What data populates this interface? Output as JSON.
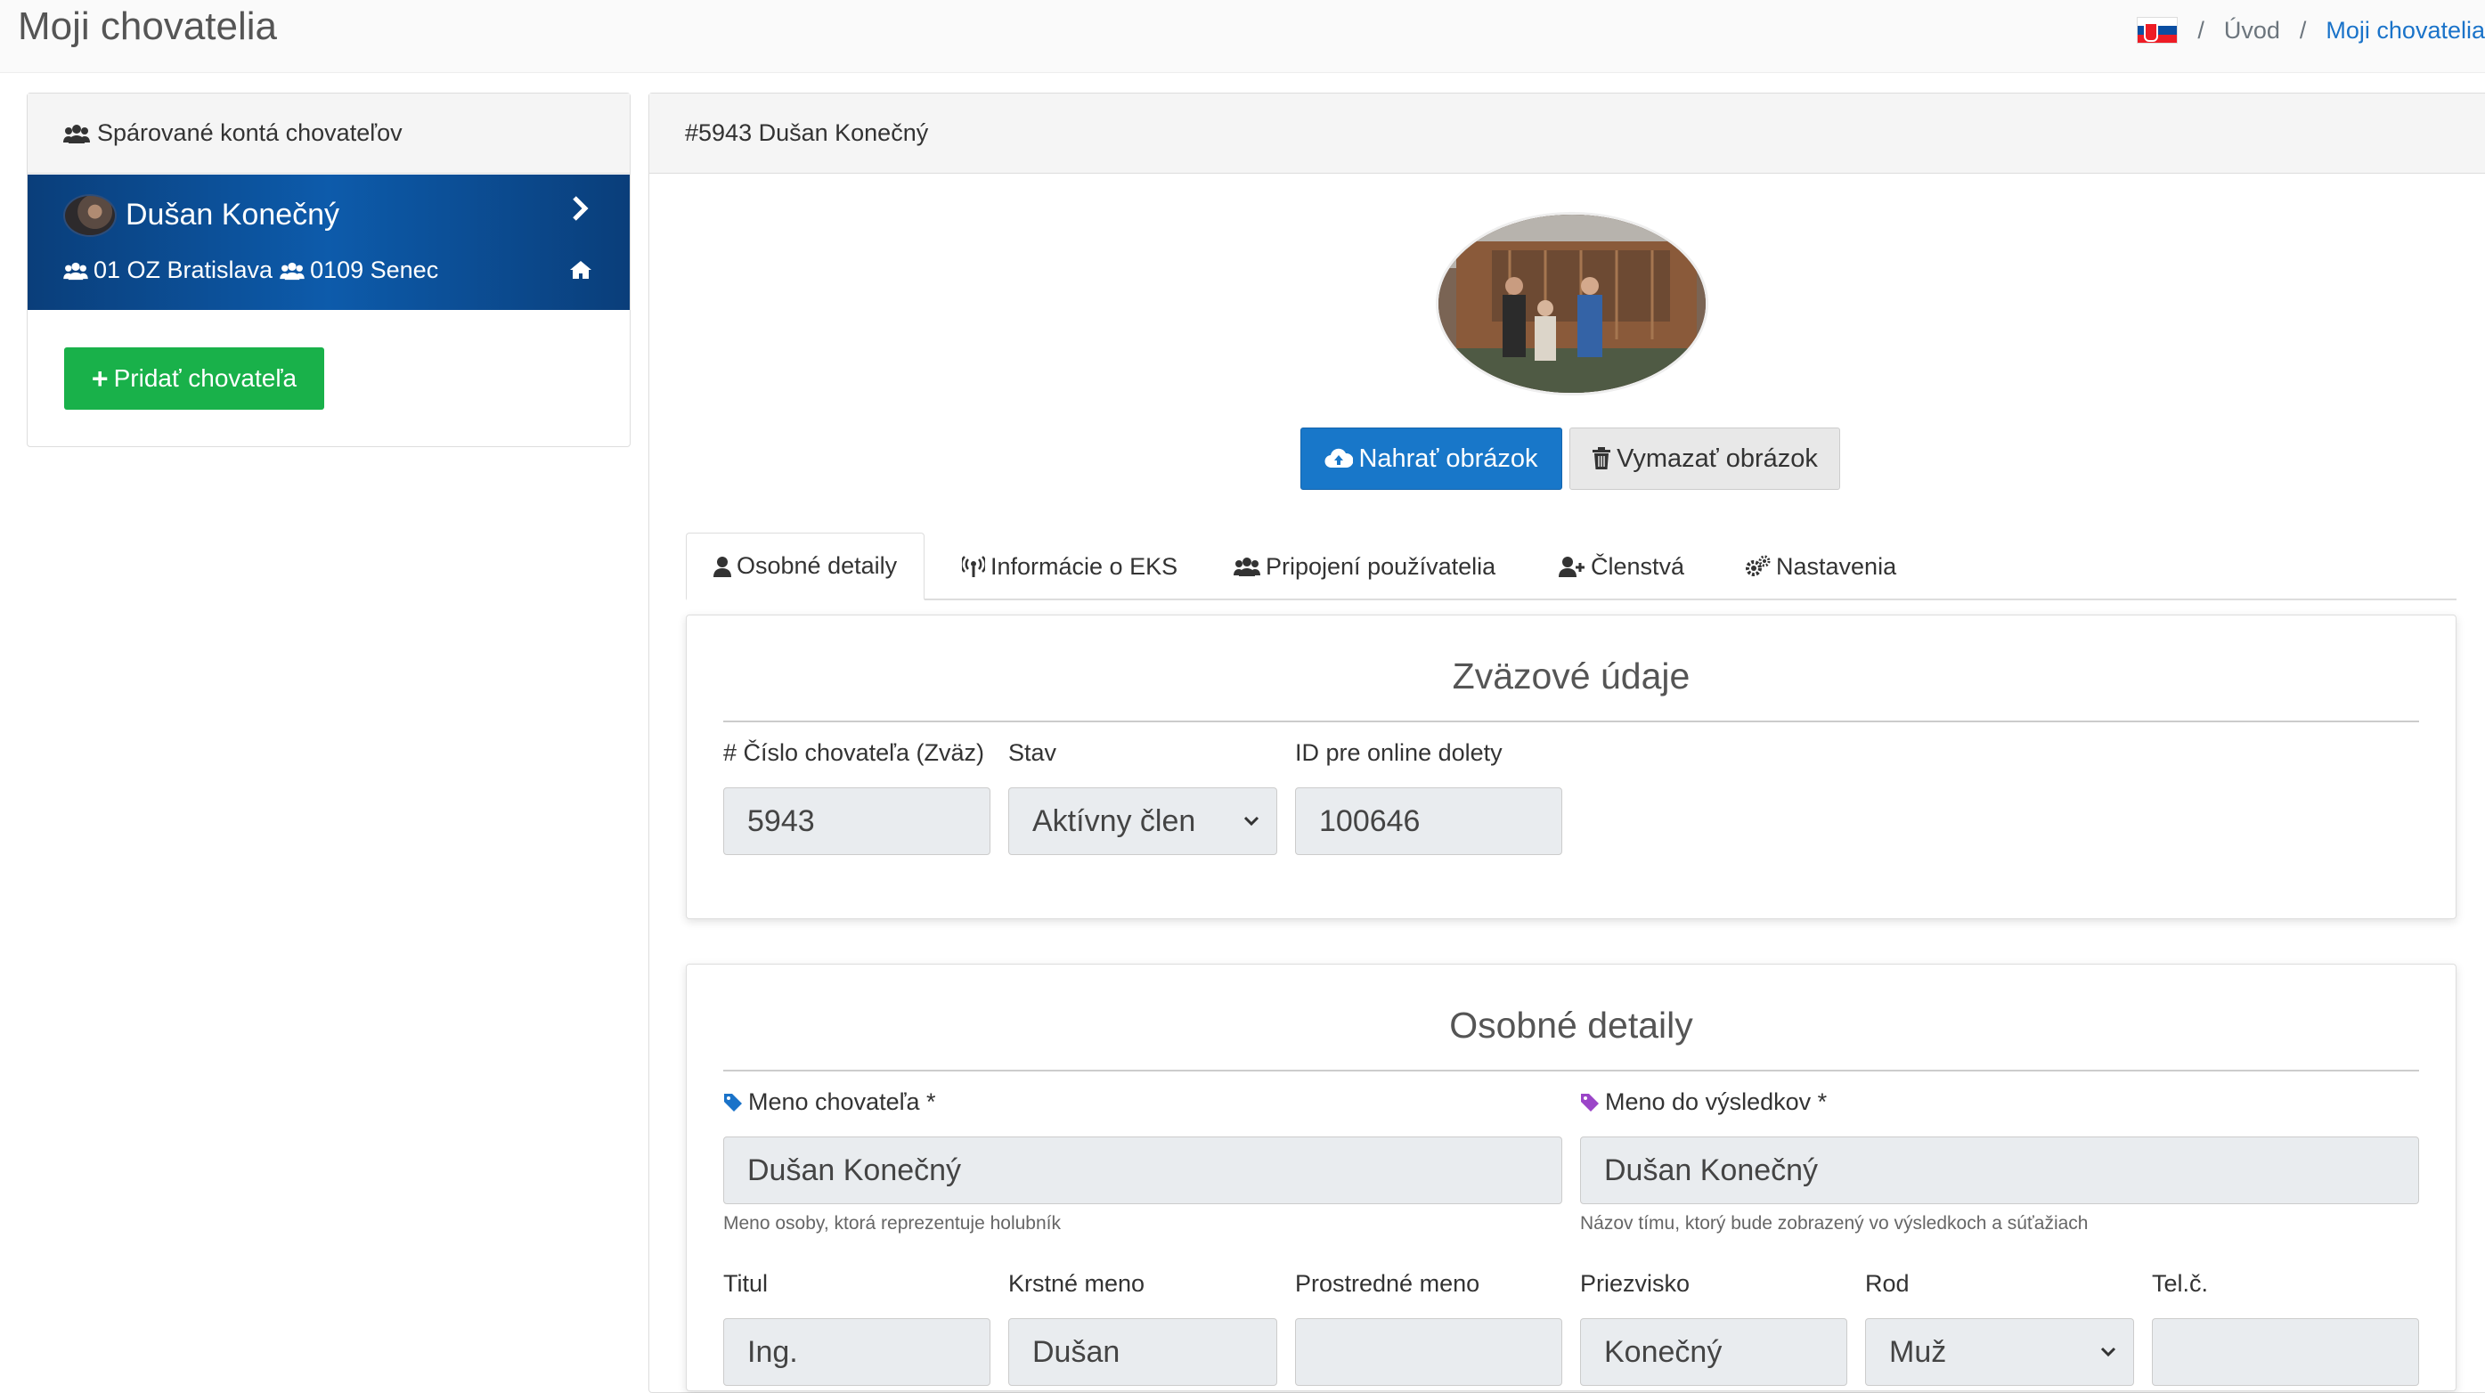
{
  "header": {
    "title": "Moji chovatelia",
    "breadcrumb": {
      "home": "Úvod",
      "sep": "/",
      "current": "Moji chovatelia"
    },
    "flag": "slovakia-flag"
  },
  "sidebar": {
    "heading": "Spárované kontá chovateľov",
    "breeder": {
      "name": "Dušan Konečný",
      "org": "01 OZ Bratislava",
      "club": "0109 Senec"
    },
    "add_button": "Pridať chovateľa"
  },
  "profile": {
    "heading": "#5943 Dušan Konečný",
    "upload_button": "Nahrať obrázok",
    "delete_button": "Vymazať obrázok"
  },
  "tabs": [
    {
      "label": "Osobné detaily",
      "icon": "user-icon",
      "active": true
    },
    {
      "label": "Informácie o EKS",
      "icon": "broadcast-icon",
      "active": false
    },
    {
      "label": "Pripojení používatelia",
      "icon": "users-icon",
      "active": false
    },
    {
      "label": "Členstvá",
      "icon": "user-plus-icon",
      "active": false
    },
    {
      "label": "Nastavenia",
      "icon": "cogs-icon",
      "active": false
    }
  ],
  "union": {
    "title": "Zväzové údaje",
    "number_label": "# Číslo chovateľa (Zväz)",
    "number_value": "5943",
    "status_label": "Stav",
    "status_value": "Aktívny člen",
    "online_label": "ID pre online dolety",
    "online_value": "100646"
  },
  "personal": {
    "title": "Osobné detaily",
    "name_label": "Meno chovateľa *",
    "name_value": "Dušan Konečný",
    "name_help": "Meno osoby, ktorá reprezentuje holubník",
    "result_label": "Meno do výsledkov *",
    "result_value": "Dušan Konečný",
    "result_help": "Názov tímu, ktorý bude zobrazený vo výsledkoch a súťažiach",
    "fields": [
      {
        "label": "Titul",
        "value": "Ing."
      },
      {
        "label": "Krstné meno",
        "value": "Dušan"
      },
      {
        "label": "Prostredné meno",
        "value": ""
      },
      {
        "label": "Priezvisko",
        "value": "Konečný"
      },
      {
        "label": "Rod",
        "value": "Muž"
      },
      {
        "label": "Tel.č.",
        "value": ""
      }
    ]
  },
  "colors": {
    "primary": "#1877c9",
    "success": "#19b14a",
    "sidebar_active": "#0d4f97",
    "tag_blue": "#1a73c9",
    "tag_purple": "#9b45c8"
  }
}
